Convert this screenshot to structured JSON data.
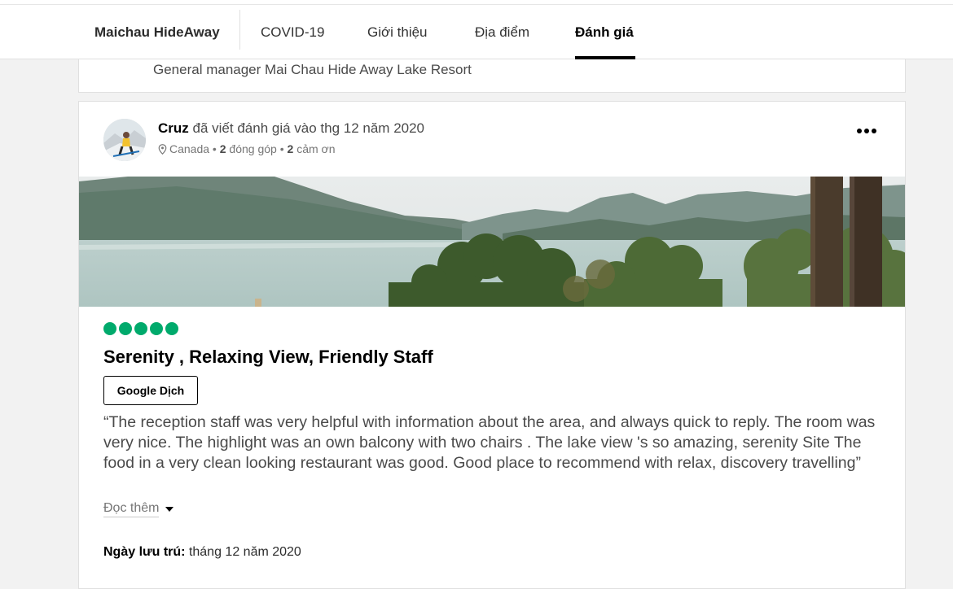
{
  "nav": {
    "brand": "Maichau HideAway",
    "tabs": [
      {
        "label": "COVID-19"
      },
      {
        "label": "Giới thiệu"
      },
      {
        "label": "Địa điểm"
      },
      {
        "label": "Đánh giá",
        "active": true
      }
    ]
  },
  "previous_response": {
    "signature": "General manager Mai Chau Hide Away Lake Resort"
  },
  "review": {
    "author": "Cruz",
    "written_text": "đã viết đánh giá vào thg 12 năm 2020",
    "location": "Canada",
    "contributions_count": "2",
    "contributions_label": "đóng góp",
    "helpful_count": "2",
    "helpful_label": "cảm ơn",
    "rating": 5,
    "rating_max": 5,
    "title": "Serenity , Relaxing View, Friendly Staff",
    "translate_button": "Google Dịch",
    "body": "“The reception staff was very helpful with information about the area, and always quick to reply. The room was very nice. The highlight was an own balcony with two chairs . The lake view 's so amazing, serenity Site The food in a very clean looking restaurant was good. Good place to recommend with relax, discovery travelling”",
    "read_more": "Đọc thêm",
    "stay_label": "Ngày lưu trú:",
    "stay_value": "tháng 12 năm 2020"
  },
  "colors": {
    "rating_bubble": "#00aa6c",
    "active_tab_underline": "#000000"
  },
  "icons": [
    "map-pin-icon",
    "more-options-icon",
    "caret-down-icon"
  ]
}
